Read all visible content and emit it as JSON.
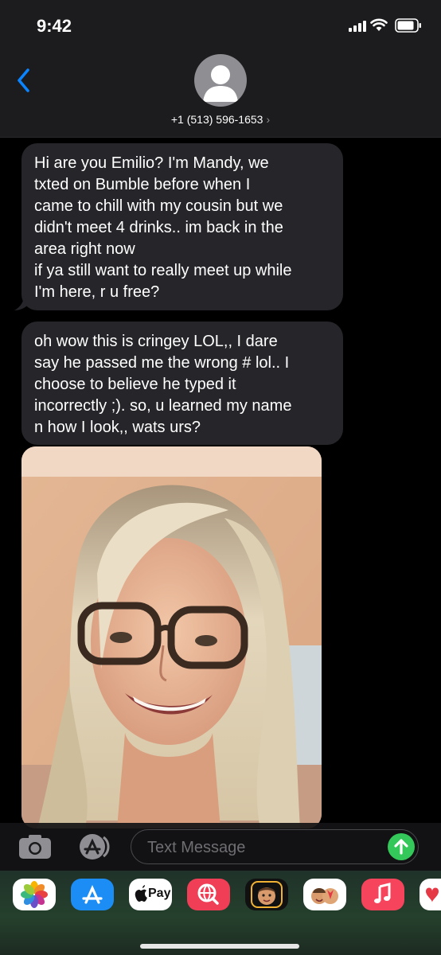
{
  "status_bar": {
    "time": "9:42",
    "icons": [
      "cellular-signal-icon",
      "wifi-icon",
      "battery-icon"
    ]
  },
  "header": {
    "back_icon": "chevron-left-icon",
    "avatar_icon": "person-silhouette-icon",
    "contact": "+1 (513) 596-1653",
    "contact_chevron": "›"
  },
  "messages": [
    {
      "direction": "incoming",
      "lines": [
        "Hi are you Emilio? I'm Mandy, we",
        "txted on Bumble before when I",
        "came to chill with my cousin but we",
        "didn't meet 4 drinks.. im back in the",
        "area right now",
        "if ya still want to really meet up while",
        "I'm here, r u free?"
      ]
    },
    {
      "direction": "incoming",
      "lines": [
        "oh wow this is cringey LOL,, I dare",
        "say he passed me the wrong # lol.. I",
        "choose to believe he typed it",
        "incorrectly ;). so, u learned my name",
        "n how I look,, wats urs?"
      ]
    },
    {
      "direction": "incoming",
      "type": "photo",
      "subject": "selfie of blonde woman with tortoiseshell glasses"
    }
  ],
  "composer": {
    "placeholder": "Text Message",
    "camera_icon": "camera-icon",
    "appstore_icon": "app-store-icon",
    "send_icon": "send-arrow-up-icon"
  },
  "app_drawer": {
    "apps": [
      {
        "name": "photos-app-icon",
        "color": "#ffffff"
      },
      {
        "name": "app-store-app-icon",
        "color": "#1c8df5"
      },
      {
        "name": "apple-pay-app-icon",
        "color": "#ffffff",
        "label": "Pay"
      },
      {
        "name": "images-search-app-icon",
        "color": "#ef3e55"
      },
      {
        "name": "memoji-app-icon",
        "color": "#111111"
      },
      {
        "name": "memoji-stickers-app-icon",
        "color": "#ffffff"
      },
      {
        "name": "music-app-icon",
        "color": "#f5445b"
      },
      {
        "name": "heart-app-icon",
        "color": "#ffffff"
      }
    ]
  },
  "colors": {
    "accent_blue": "#0a84ff",
    "bubble_gray": "#26252a",
    "send_green": "#34c759",
    "background": "#000000"
  }
}
